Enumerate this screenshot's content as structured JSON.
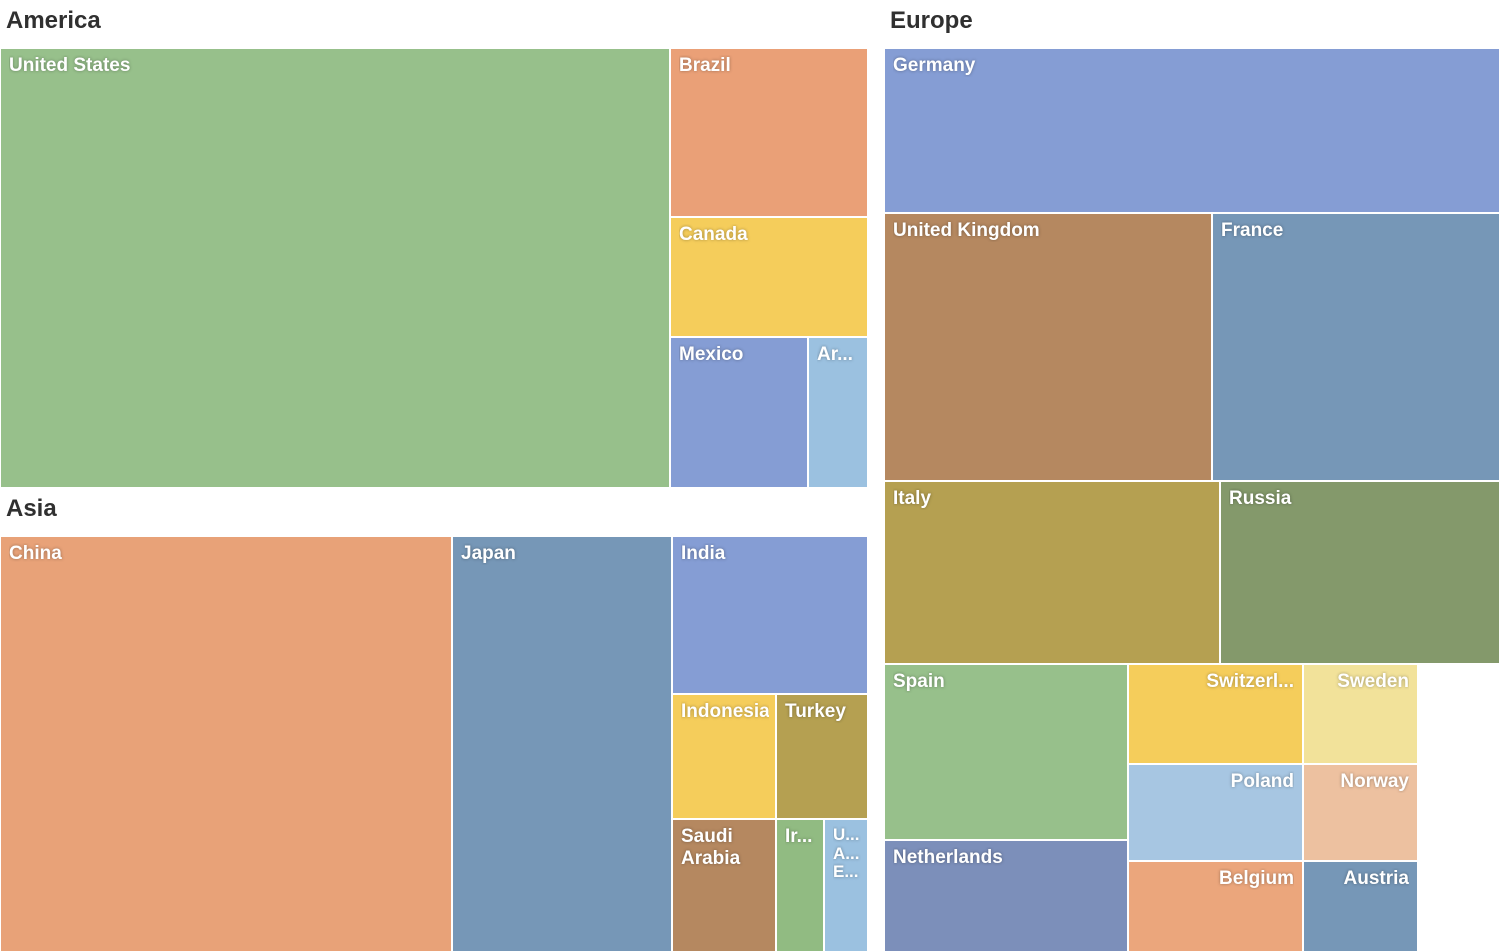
{
  "chart_data": {
    "type": "treemap",
    "title": "",
    "groups": [
      {
        "name": "America",
        "countries": [
          {
            "name": "United States",
            "value": 17348
          },
          {
            "name": "Brazil",
            "value": 2346
          },
          {
            "name": "Canada",
            "value": 1786
          },
          {
            "name": "Mexico",
            "value": 1291
          },
          {
            "name": "Argentina",
            "value": 540
          }
        ]
      },
      {
        "name": "Asia",
        "countries": [
          {
            "name": "China",
            "value": 10356
          },
          {
            "name": "Japan",
            "value": 4602
          },
          {
            "name": "India",
            "value": 2048
          },
          {
            "name": "Indonesia",
            "value": 888
          },
          {
            "name": "Turkey",
            "value": 798
          },
          {
            "name": "Saudi Arabia",
            "value": 746
          },
          {
            "name": "Iran",
            "value": 416
          },
          {
            "name": "United Arab Emirates",
            "value": 399
          }
        ]
      },
      {
        "name": "Europe",
        "countries": [
          {
            "name": "Germany",
            "value": 3874
          },
          {
            "name": "United Kingdom",
            "value": 2950
          },
          {
            "name": "France",
            "value": 2833
          },
          {
            "name": "Italy",
            "value": 2147
          },
          {
            "name": "Russia",
            "value": 1861
          },
          {
            "name": "Spain",
            "value": 1406
          },
          {
            "name": "Netherlands",
            "value": 880
          },
          {
            "name": "Switzerland",
            "value": 712
          },
          {
            "name": "Sweden",
            "value": 570
          },
          {
            "name": "Poland",
            "value": 546
          },
          {
            "name": "Belgium",
            "value": 533
          },
          {
            "name": "Norway",
            "value": 500
          },
          {
            "name": "Austria",
            "value": 437
          }
        ]
      }
    ]
  },
  "palette": [
    "#97c08b",
    "#eaa077",
    "#f5cd5b",
    "#859dd4",
    "#9bc1e0",
    "#e8a278",
    "#7697b7",
    "#859dd4",
    "#f5cd5b",
    "#b5a051",
    "#b58860",
    "#91bb82",
    "#9bc1e0",
    "#859dd4",
    "#b58860",
    "#7697b7",
    "#b5a051",
    "#84996b",
    "#97c08b",
    "#7c8fba",
    "#f5cd5b",
    "#f2e29a",
    "#a7c6e2",
    "#eba67c",
    "#edc1a0",
    "#7697b7"
  ],
  "labels": {
    "groups": {
      "america": "America",
      "asia": "Asia",
      "europe": "Europe"
    },
    "countries": {
      "us": "United States",
      "brazil": "Brazil",
      "canada": "Canada",
      "mexico": "Mexico",
      "argentina": "Ar...",
      "china": "China",
      "japan": "Japan",
      "india": "India",
      "indonesia": "Indonesia",
      "turkey": "Turkey",
      "saudi": "Saudi Arabia",
      "iran": "Ir...",
      "uae": "U... A... E...",
      "germany": "Germany",
      "uk": "United Kingdom",
      "france": "France",
      "italy": "Italy",
      "russia": "Russia",
      "spain": "Spain",
      "netherlands": "Netherlands",
      "switzerland": "Switzerl...",
      "sweden": "Sweden",
      "poland": "Poland",
      "belgium": "Belgium",
      "norway": "Norway",
      "austria": "Austria"
    }
  }
}
